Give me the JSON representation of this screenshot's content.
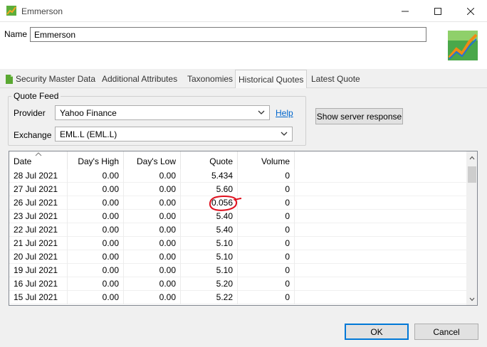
{
  "window": {
    "title": "Emmerson",
    "icons": {
      "app": "chart-app-icon",
      "minimize": "minimize-icon",
      "maximize": "maximize-icon",
      "close": "close-icon"
    }
  },
  "name_field": {
    "label": "Name",
    "value": "Emmerson"
  },
  "tabs": [
    {
      "label": "Security Master Data",
      "icon": "document-icon"
    },
    {
      "label": "Additional Attributes"
    },
    {
      "label": "Taxonomies"
    },
    {
      "label": "Historical Quotes",
      "active": true
    },
    {
      "label": "Latest Quote"
    }
  ],
  "quote_feed": {
    "legend": "Quote Feed",
    "provider_label": "Provider",
    "provider_value": "Yahoo Finance",
    "help_link": "Help",
    "exchange_label": "Exchange",
    "exchange_value": "EML.L (EML.L)",
    "server_button": "Show server response"
  },
  "table": {
    "columns": [
      "Date",
      "Day's High",
      "Day's Low",
      "Quote",
      "Volume"
    ],
    "rows": [
      [
        "28 Jul 2021",
        "0.00",
        "0.00",
        "5.434",
        "0"
      ],
      [
        "27 Jul 2021",
        "0.00",
        "0.00",
        "5.60",
        "0"
      ],
      [
        "26 Jul 2021",
        "0.00",
        "0.00",
        "0.056",
        "0"
      ],
      [
        "23 Jul 2021",
        "0.00",
        "0.00",
        "5.40",
        "0"
      ],
      [
        "22 Jul 2021",
        "0.00",
        "0.00",
        "5.40",
        "0"
      ],
      [
        "21 Jul 2021",
        "0.00",
        "0.00",
        "5.10",
        "0"
      ],
      [
        "20 Jul 2021",
        "0.00",
        "0.00",
        "5.10",
        "0"
      ],
      [
        "19 Jul 2021",
        "0.00",
        "0.00",
        "5.10",
        "0"
      ],
      [
        "16 Jul 2021",
        "0.00",
        "0.00",
        "5.20",
        "0"
      ],
      [
        "15 Jul 2021",
        "0.00",
        "0.00",
        "5.22",
        "0"
      ]
    ],
    "annotation_color": "#e0101e"
  },
  "buttons": {
    "ok": "OK",
    "cancel": "Cancel"
  },
  "colors": {
    "accent": "#0078d7",
    "link": "#0066cc"
  }
}
